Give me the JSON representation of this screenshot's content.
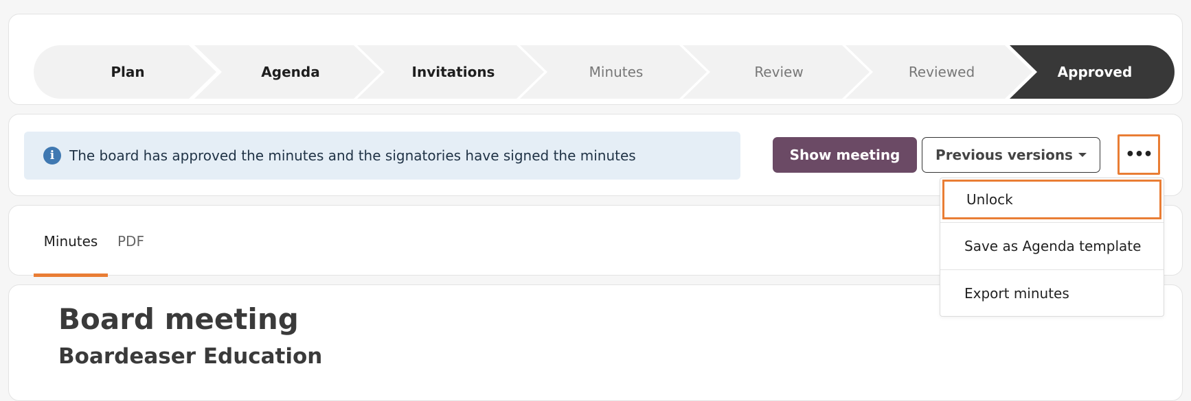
{
  "stepper": {
    "steps": [
      {
        "label": "Plan",
        "state": "done"
      },
      {
        "label": "Agenda",
        "state": "done"
      },
      {
        "label": "Invitations",
        "state": "done"
      },
      {
        "label": "Minutes",
        "state": "todo"
      },
      {
        "label": "Review",
        "state": "todo"
      },
      {
        "label": "Reviewed",
        "state": "todo"
      },
      {
        "label": "Approved",
        "state": "current"
      }
    ]
  },
  "status": {
    "info_icon": "info-circle-icon",
    "message": "The board has approved the minutes and the signatories have signed the minutes",
    "show_meeting_label": "Show meeting",
    "previous_versions_label": "Previous versions",
    "more_label": "•••"
  },
  "menu": {
    "items": [
      {
        "label": "Unlock"
      },
      {
        "label": "Save as Agenda template"
      },
      {
        "label": "Export minutes"
      }
    ]
  },
  "tabs": [
    {
      "label": "Minutes",
      "active": true
    },
    {
      "label": "PDF",
      "active": false
    }
  ],
  "document": {
    "title": "Board meeting",
    "subtitle": "Boardeaser Education"
  },
  "colors": {
    "accent": "#e97d34",
    "primary_button": "#6b4a65",
    "current_step": "#383838",
    "info_banner": "#e5eef6"
  }
}
